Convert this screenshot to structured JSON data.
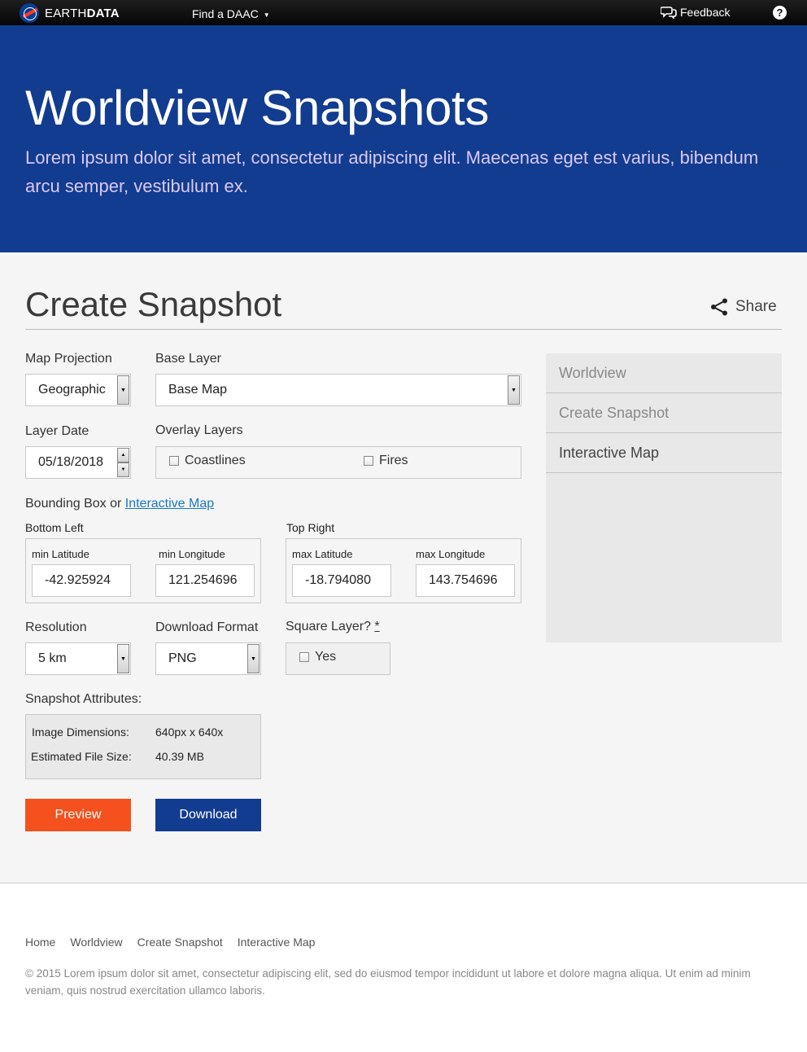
{
  "topbar": {
    "brand_light": "EARTH",
    "brand_bold": "DATA",
    "daac_label": "Find a DAAC",
    "feedback_label": "Feedback",
    "help_glyph": "?"
  },
  "hero": {
    "title": "Worldview Snapshots",
    "subtitle": "Lorem ipsum dolor sit amet, consectetur adipiscing elit. Maecenas eget est varius, bibendum arcu semper, vestibulum ex."
  },
  "main": {
    "title": "Create Snapshot",
    "share_label": "Share"
  },
  "form": {
    "projection": {
      "label": "Map Projection",
      "value": "Geographic"
    },
    "base_layer": {
      "label": "Base Layer",
      "value": "Base Map"
    },
    "layer_date": {
      "label": "Layer Date",
      "value": "05/18/2018"
    },
    "overlay": {
      "label": "Overlay Layers",
      "options": [
        "Coastlines",
        "Fires"
      ]
    },
    "bbox": {
      "label_prefix": "Bounding Box or",
      "link": "Interactive Map",
      "bottom_left_label": "Bottom Left",
      "top_right_label": "Top Right",
      "min_lat_label": "min Latitude",
      "min_lat": "-42.925924",
      "min_lon_label": "min Longitude",
      "min_lon": "121.254696",
      "max_lat_label": "max Latitude",
      "max_lat": "-18.794080",
      "max_lon_label": "max Longitude",
      "max_lon": "143.754696"
    },
    "resolution": {
      "label": "Resolution",
      "value": "5 km"
    },
    "format": {
      "label": "Download Format",
      "value": "PNG"
    },
    "square": {
      "label": "Square Layer?",
      "marker": "*",
      "option": "Yes"
    },
    "attributes": {
      "label": "Snapshot Attributes:",
      "dim_label": "Image Dimensions:",
      "dim_value": "640px x 640x",
      "size_label": "Estimated File Size:",
      "size_value": "40.39 MB"
    },
    "preview_label": "Preview",
    "download_label": "Download"
  },
  "sidenav": {
    "items": [
      "Worldview",
      "Create Snapshot",
      "Interactive Map"
    ]
  },
  "footer": {
    "links": [
      "Home",
      "Worldview",
      "Create Snapshot",
      "Interactive Map"
    ],
    "copyright": "© 2015 Lorem ipsum dolor sit amet, consectetur adipiscing elit, sed do eiusmod tempor incididunt ut labore et dolore magna aliqua. Ut enim ad minim veniam, quis nostrud exercitation ullamco laboris."
  },
  "colors": {
    "hero_bg": "#123c8f",
    "preview_bg": "#f4511e",
    "download_bg": "#123c8f",
    "link": "#1a79c8"
  }
}
